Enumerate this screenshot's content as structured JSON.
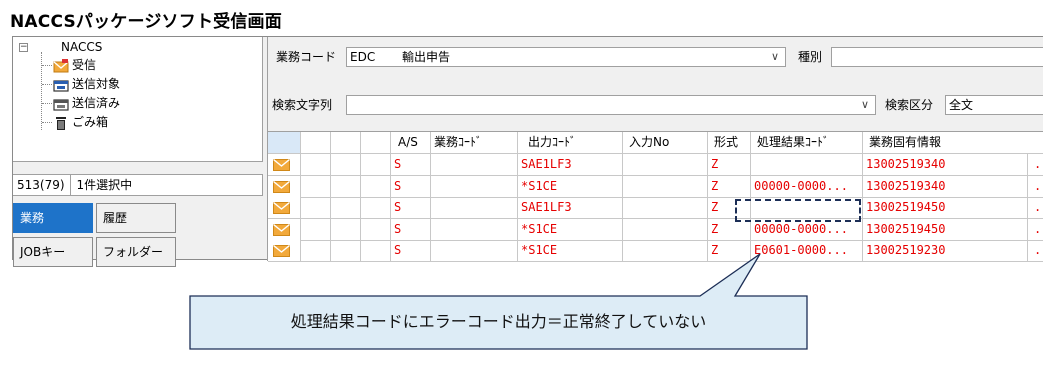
{
  "page": {
    "title": "NACCSパッケージソフト受信画面"
  },
  "tree": {
    "root": "NACCS",
    "items": [
      {
        "label": "受信",
        "icon": "inbox-mail-icon"
      },
      {
        "label": "送信対象",
        "icon": "outbox-icon"
      },
      {
        "label": "送信済み",
        "icon": "sent-box-icon"
      },
      {
        "label": "ごみ箱",
        "icon": "trash-icon"
      }
    ]
  },
  "status": {
    "count": "513(79)",
    "selection": "1件選択中"
  },
  "tabs": [
    {
      "label": "業務",
      "active": true
    },
    {
      "label": "履歴",
      "active": false
    },
    {
      "label": "JOBキー",
      "active": false
    },
    {
      "label": "フォルダー",
      "active": false
    }
  ],
  "filters": {
    "business_code_label": "業務コード",
    "business_code_value": "EDC",
    "business_code_name": "輸出申告",
    "type_label": "種別",
    "search_text_label": "検索文字列",
    "search_text_value": "",
    "search_category_label": "検索区分",
    "search_category_value": "全文"
  },
  "grid": {
    "columns": [
      "A/S",
      "業務ｺｰﾄﾞ",
      "出力ｺｰﾄﾞ",
      "入力No",
      "形式",
      "処理結果ｺｰﾄﾞ",
      "業務固有情報"
    ],
    "rows": [
      {
        "as": "S",
        "output_code": "SAE1LF3",
        "format": "Z",
        "result_code": "",
        "info": "13002519340",
        "more": ".."
      },
      {
        "as": "S",
        "output_code": "*S1CE",
        "format": "Z",
        "result_code": "00000-0000...",
        "info": "13002519340",
        "more": ".."
      },
      {
        "as": "S",
        "output_code": "SAE1LF3",
        "format": "Z",
        "result_code": "",
        "info": "13002519450",
        "more": ".."
      },
      {
        "as": "S",
        "output_code": "*S1CE",
        "format": "Z",
        "result_code": "00000-0000...",
        "info": "13002519450",
        "more": ".."
      },
      {
        "as": "S",
        "output_code": "*S1CE",
        "format": "Z",
        "result_code": "E0601-0000...",
        "info": "13002519230",
        "more": ".."
      }
    ]
  },
  "callout": {
    "text": "処理結果コードにエラーコード出力＝正常終了していない"
  },
  "colors": {
    "accent": "#1e73c9",
    "error_text": "#e60000",
    "callout_fill": "#ddecf6",
    "callout_border": "#1c2e56",
    "mail_icon": "#f2a93b"
  }
}
